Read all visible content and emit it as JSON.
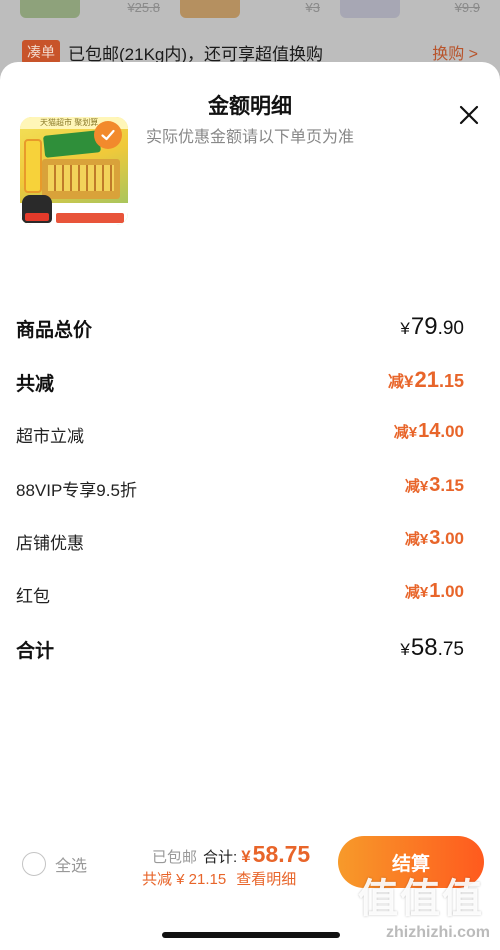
{
  "background": {
    "prices": [
      "¥25.8",
      "¥3",
      "¥9.9"
    ],
    "banner": {
      "tag": "凑单",
      "text": "已包邮(21Kg内)，还可享超值换购",
      "link": "换购 >"
    }
  },
  "sheet": {
    "title": "金额明细",
    "subtitle": "实际优惠金额请以下单页为准",
    "close_icon": "close-icon"
  },
  "product": {
    "top_text": "天猫超市 聚划算"
  },
  "rows": [
    {
      "label": "商品总价",
      "prefix": "",
      "currency": "¥",
      "int": "79",
      "dec": ".90"
    },
    {
      "label": "共减",
      "prefix": "减",
      "currency": "¥",
      "int": "21",
      "dec": ".15"
    },
    {
      "label": "超市立减",
      "prefix": "减",
      "currency": "¥",
      "int": "14",
      "dec": ".00"
    },
    {
      "label": "88VIP专享9.5折",
      "prefix": "减",
      "currency": "¥",
      "int": "3",
      "dec": ".15"
    },
    {
      "label": "店铺优惠",
      "prefix": "减",
      "currency": "¥",
      "int": "3",
      "dec": ".00"
    },
    {
      "label": "红包",
      "prefix": "减",
      "currency": "¥",
      "int": "1",
      "dec": ".00"
    },
    {
      "label": "合计",
      "prefix": "",
      "currency": "¥",
      "int": "58",
      "dec": ".75"
    }
  ],
  "footer": {
    "select_all": "全选",
    "free_shipping": "已包邮",
    "total_label": "合计:",
    "total_currency": "¥",
    "total_value": "58.75",
    "saved": "共减 ¥ 21.15",
    "view_detail": "查看明细",
    "checkout": "结算"
  },
  "watermark": {
    "logo": "值值值",
    "url": "zhizhizhi.com"
  },
  "colors": {
    "accent": "#e8652a",
    "checkout_start": "#f79a2a",
    "checkout_end": "#ff5a1e",
    "check_badge": "#f28a2c"
  }
}
